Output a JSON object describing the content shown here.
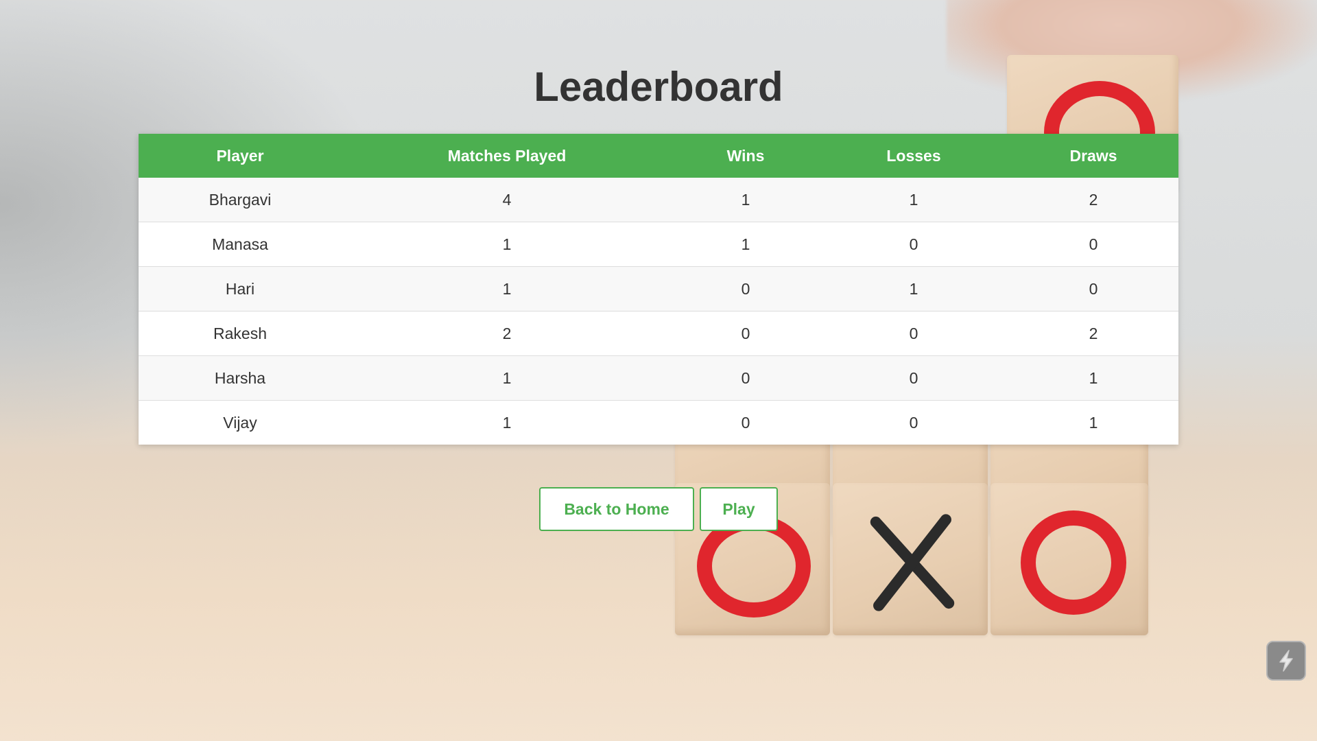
{
  "page": {
    "title": "Leaderboard"
  },
  "leaderboard": {
    "columns": [
      "Player",
      "Matches Played",
      "Wins",
      "Losses",
      "Draws"
    ],
    "rows": [
      [
        "Bhargavi",
        "4",
        "1",
        "1",
        "2"
      ],
      [
        "Manasa",
        "1",
        "1",
        "0",
        "0"
      ],
      [
        "Hari",
        "1",
        "0",
        "1",
        "0"
      ],
      [
        "Rakesh",
        "2",
        "0",
        "0",
        "2"
      ],
      [
        "Harsha",
        "1",
        "0",
        "0",
        "1"
      ],
      [
        "Vijay",
        "1",
        "0",
        "0",
        "1"
      ]
    ]
  },
  "actions": {
    "back_home_label": "Back to Home",
    "play_label": "Play"
  },
  "colors": {
    "accent": "#4caf50",
    "text": "#333333",
    "mark_o": "#e0262d",
    "mark_x": "#2b2b2b"
  },
  "icons": {
    "floating_button": "lightning-bolt-icon"
  }
}
